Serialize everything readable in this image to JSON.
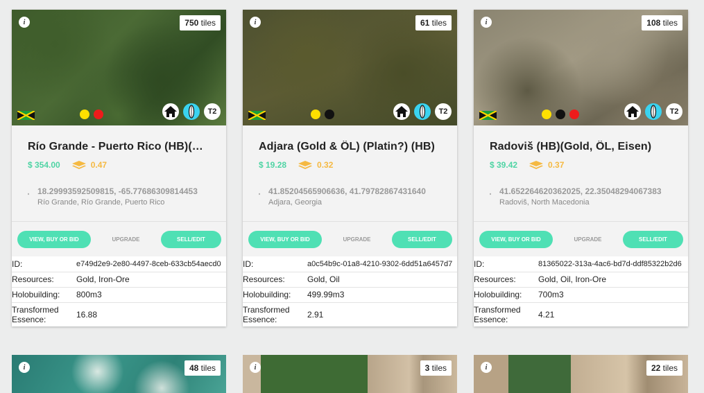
{
  "cards": [
    {
      "tiles_count": "750",
      "tiles_unit": "tiles",
      "dots": [
        "#ffe000",
        "#ee1b1b"
      ],
      "title": "Río Grande - Puerto Rico (HB)(Gold,Eisen,...",
      "price": "$ 354.00",
      "yield": "0.47",
      "coords": "18.29993592509815, -65.77686309814453",
      "place": "Río Grande, Río Grande, Puerto Rico",
      "id": "e749d2e9-2e80-4497-8ceb-633cb54aecd0",
      "resources": "Gold, Iron-Ore",
      "holobuilding": "800m3",
      "essence": "16.88"
    },
    {
      "tiles_count": "61",
      "tiles_unit": "tiles",
      "dots": [
        "#ffe000",
        "#111111"
      ],
      "title": "Adjara (Gold & ÖL) (Platin?) (HB)",
      "price": "$ 19.28",
      "yield": "0.32",
      "coords": "41.85204565906636, 41.79782867431640",
      "place": "Adjara, Georgia",
      "id": "a0c54b9c-01a8-4210-9302-6dd51a6457d7",
      "resources": "Gold, Oil",
      "holobuilding": "499.99m3",
      "essence": "2.91"
    },
    {
      "tiles_count": "108",
      "tiles_unit": "tiles",
      "dots": [
        "#ffe000",
        "#111111",
        "#ee1b1b"
      ],
      "title": "Radoviš (HB)(Gold, ÖL, Eisen)",
      "price": "$ 39.42",
      "yield": "0.37",
      "coords": "41.652264620362025, 22.35048294067383",
      "place": "Radoviš, North Macedonia",
      "id": "81365022-313a-4ac6-bd7d-ddf85322b2d6",
      "resources": "Gold, Oil, Iron-Ore",
      "holobuilding": "700m3",
      "essence": "4.21"
    }
  ],
  "bottom_cards": [
    {
      "tiles_count": "48",
      "tiles_unit": "tiles"
    },
    {
      "tiles_count": "3",
      "tiles_unit": "tiles"
    },
    {
      "tiles_count": "22",
      "tiles_unit": "tiles"
    }
  ],
  "labels": {
    "info": "i",
    "tier": "T2",
    "view_buy_bid": "VIEW, BUY OR BID",
    "upgrade": "UPGRADE",
    "sell_edit": "SELL/EDIT",
    "id": "ID:",
    "resources": "Resources:",
    "holobuilding": "Holobuilding:",
    "essence_line1": "Transformed",
    "essence_line2": "Essence:"
  },
  "colors": {
    "accent_green": "#4fe0b4",
    "price_green": "#4fd4a4",
    "yield_orange": "#f5b942",
    "badge_cyan": "#3ad3f0"
  },
  "icons": [
    "info-icon",
    "jamaica-flag-icon",
    "home-icon",
    "surfboard-icon",
    "layers-icon",
    "location-pin-icon"
  ]
}
